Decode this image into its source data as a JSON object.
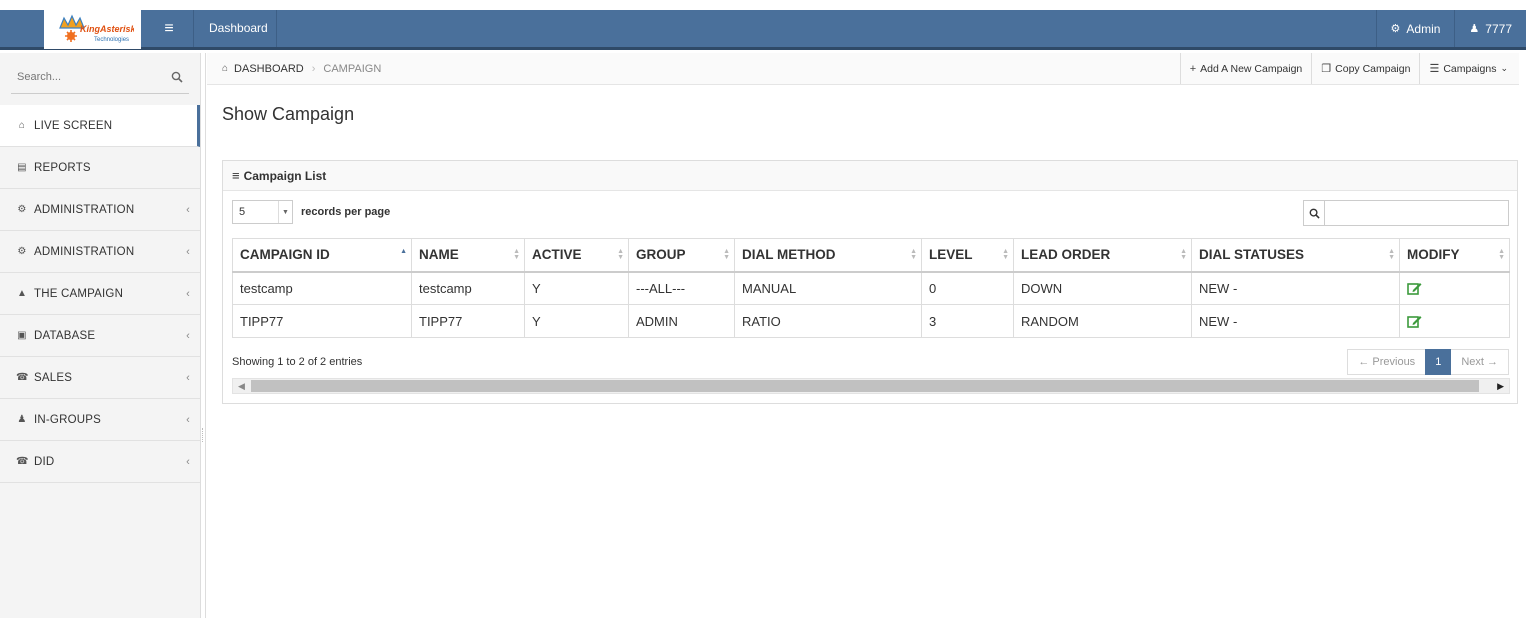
{
  "brand": {
    "name": "KingAsterisk",
    "sub": "Technologies"
  },
  "topbar": {
    "dashboard_label": "Dashboard",
    "admin_label": "Admin",
    "user_label": "7777"
  },
  "sidebar": {
    "search_placeholder": "Search...",
    "items": [
      {
        "label": "LIVE SCREEN",
        "icon": "home-icon"
      },
      {
        "label": "REPORTS",
        "icon": "chart-icon"
      },
      {
        "label": "ADMINISTRATION",
        "icon": "gear-icon"
      },
      {
        "label": "ADMINISTRATION",
        "icon": "gear-icon"
      },
      {
        "label": "THE CAMPAIGN",
        "icon": "bullhorn-icon"
      },
      {
        "label": "DATABASE",
        "icon": "database-icon"
      },
      {
        "label": "SALES",
        "icon": "phone-icon"
      },
      {
        "label": "IN-GROUPS",
        "icon": "user-icon"
      },
      {
        "label": "DID",
        "icon": "phone-icon"
      }
    ]
  },
  "breadcrumb": {
    "home": "DASHBOARD",
    "current": "CAMPAIGN"
  },
  "actions": {
    "add": "Add A New Campaign",
    "copy": "Copy Campaign",
    "campaigns": "Campaigns"
  },
  "page": {
    "title": "Show Campaign"
  },
  "panel": {
    "title": "Campaign List",
    "length_value": "5",
    "length_label": "records per page",
    "columns": [
      "CAMPAIGN ID",
      "NAME",
      "ACTIVE",
      "GROUP",
      "DIAL METHOD",
      "LEVEL",
      "LEAD ORDER",
      "DIAL STATUSES",
      "MODIFY"
    ],
    "rows": [
      [
        "testcamp",
        "testcamp",
        "Y",
        "---ALL---",
        "MANUAL",
        "0",
        "DOWN",
        "NEW -"
      ],
      [
        "TIPP77",
        "TIPP77",
        "Y",
        "ADMIN",
        "RATIO",
        "3",
        "RANDOM",
        "NEW -"
      ]
    ],
    "info": "Showing 1 to 2 of 2 entries",
    "pager": {
      "prev": "← Previous",
      "current": "1",
      "next": "Next →"
    }
  },
  "colors": {
    "brand": "#4a709b",
    "edit": "#3c9a3c"
  }
}
